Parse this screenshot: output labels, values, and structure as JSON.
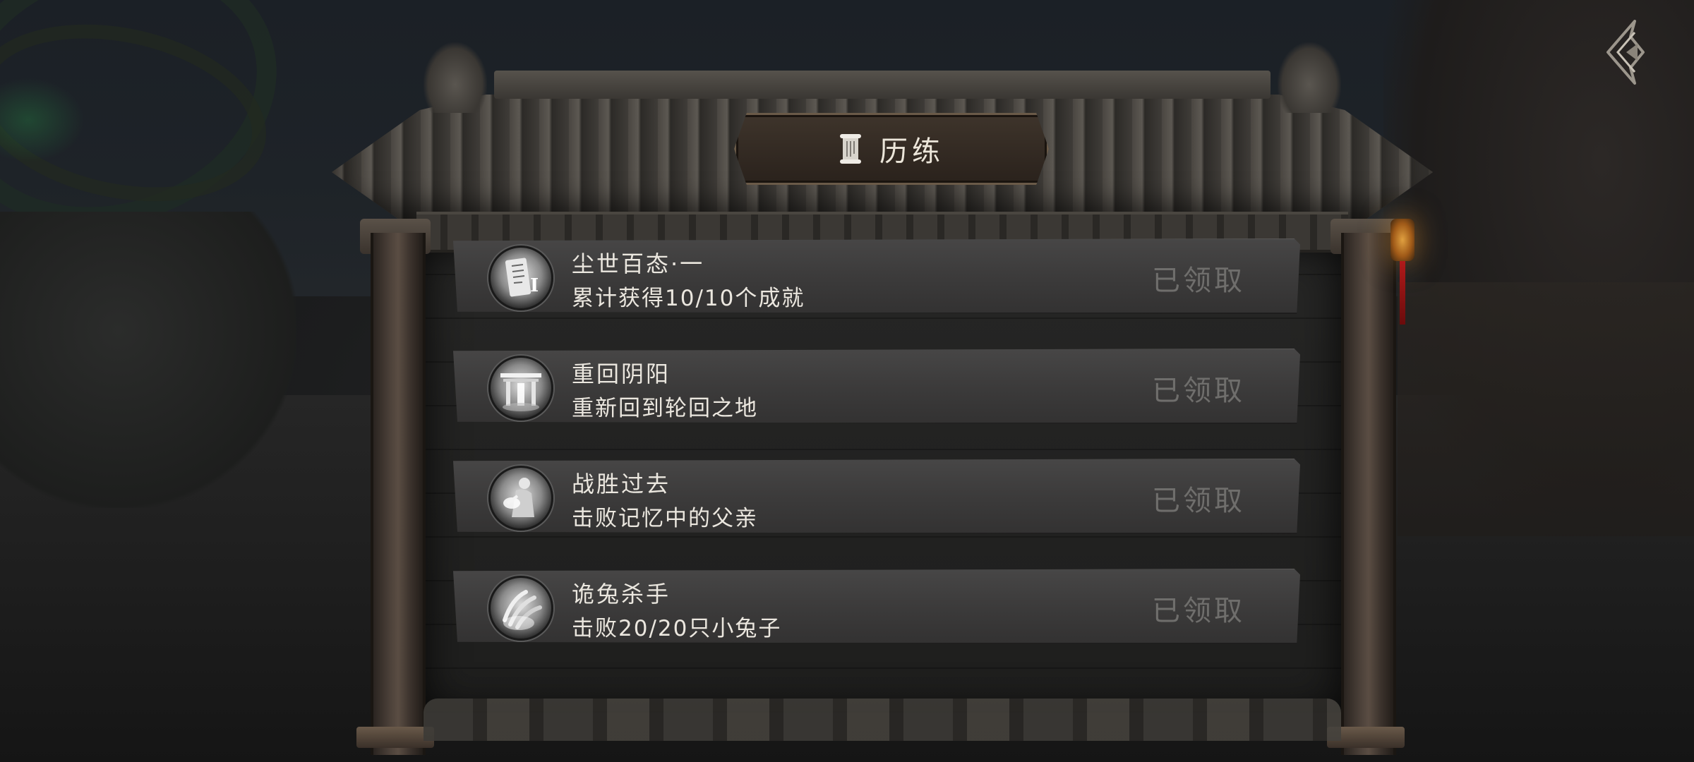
{
  "header": {
    "title": "历练",
    "title_icon": "scroll-icon"
  },
  "achievements": [
    {
      "title": "尘世百态·一",
      "desc": "累计获得10/10个成就",
      "status": "已领取",
      "icon": "scroll-badge-icon"
    },
    {
      "title": "重回阴阳",
      "desc": "重新回到轮回之地",
      "status": "已领取",
      "icon": "gate-badge-icon"
    },
    {
      "title": "战胜过去",
      "desc": "击败记忆中的父亲",
      "status": "已领取",
      "icon": "warrior-badge-icon"
    },
    {
      "title": "诡兔杀手",
      "desc": "击败20/20只小兔子",
      "status": "已领取",
      "icon": "claw-badge-icon"
    }
  ],
  "controls": {
    "back_icon": "back-arrow-icon"
  },
  "colors": {
    "text": "#ebe7df",
    "claimed": "#6f6e6c",
    "row_bg": "#3f3e3e",
    "lantern": "#e0a040"
  }
}
